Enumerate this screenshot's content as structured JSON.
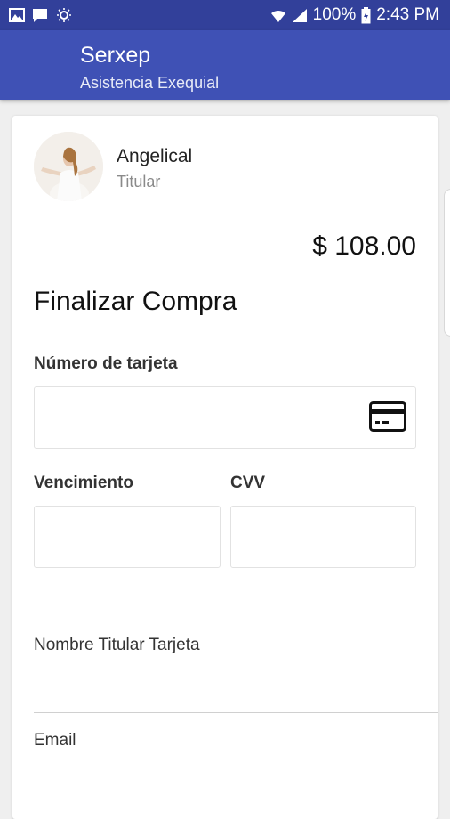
{
  "status_bar": {
    "battery": "100%",
    "time": "2:43 PM",
    "left_icons": [
      "image-icon",
      "chat-icon",
      "brightness-icon"
    ],
    "right_icons": [
      "wifi-icon",
      "signal-icon",
      "battery-icon"
    ]
  },
  "app_bar": {
    "title": "Serxep",
    "subtitle": "Asistencia Exequial",
    "color": "#3f51b5"
  },
  "profile": {
    "name": "Angelical",
    "role": "Titular"
  },
  "checkout": {
    "price": "$ 108.00",
    "heading": "Finalizar Compra",
    "card_number_label": "Número de tarjeta",
    "expiry_label": "Vencimiento",
    "cvv_label": "CVV",
    "cardholder_label": "Nombre Titular Tarjeta",
    "email_label": "Email"
  }
}
